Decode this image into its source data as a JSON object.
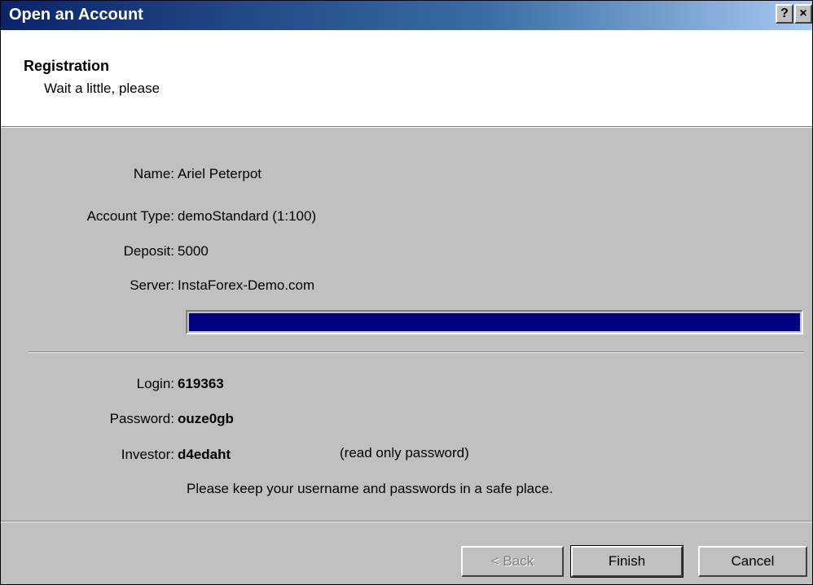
{
  "window": {
    "title": "Open an Account",
    "help_label": "?",
    "close_label": "×"
  },
  "header": {
    "title": "Registration",
    "subtitle": "Wait a little, please"
  },
  "fields": {
    "name_label": "Name:",
    "name_value": "Ariel Peterpot",
    "account_type_label": "Account Type:",
    "account_type_value": "demoStandard (1:100)",
    "deposit_label": "Deposit:",
    "deposit_value": "5000",
    "server_label": "Server:",
    "server_value": "InstaForex-Demo.com"
  },
  "progress": {
    "value": 1.0,
    "color": "#000080"
  },
  "credentials": {
    "login_label": "Login:",
    "login_value": "619363",
    "password_label": "Password:",
    "password_value": "ouze0gb",
    "investor_label": "Investor:",
    "investor_value": "d4edaht",
    "investor_note": "(read only password)",
    "safety_note": "Please keep your username and passwords in a safe place."
  },
  "buttons": {
    "back_label": "< Back",
    "finish_label": "Finish",
    "cancel_label": "Cancel"
  },
  "colors": {
    "titlebar_start": "#0a246a",
    "dialog_bg": "#c0c0c0"
  }
}
